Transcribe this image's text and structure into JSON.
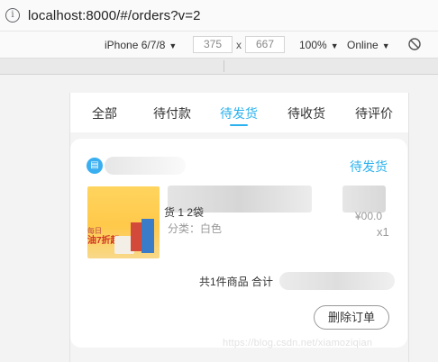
{
  "browser": {
    "url": "localhost:8000/#/orders?v=2",
    "device": "iPhone 6/7/8",
    "width": "375",
    "height": "667",
    "dim_separator": "x",
    "zoom": "100%",
    "network": "Online"
  },
  "tabs": [
    {
      "label": "全部"
    },
    {
      "label": "待付款"
    },
    {
      "label": "待发货"
    },
    {
      "label": "待收货"
    },
    {
      "label": "待评价"
    }
  ],
  "order": {
    "status": "待发货",
    "title_fragment": "货 1 2袋",
    "category": "分类：白色",
    "price_fragment": "¥00.0",
    "quantity": "x1",
    "summary": "共1件商品 合计",
    "image_promo_top": "每日",
    "image_promo": "油7折起",
    "delete_label": "删除订单"
  },
  "watermark": "https://blog.csdn.net/xiamoziqian",
  "colors": {
    "accent": "#2ab1ee",
    "store_icon": "#39aef0"
  }
}
